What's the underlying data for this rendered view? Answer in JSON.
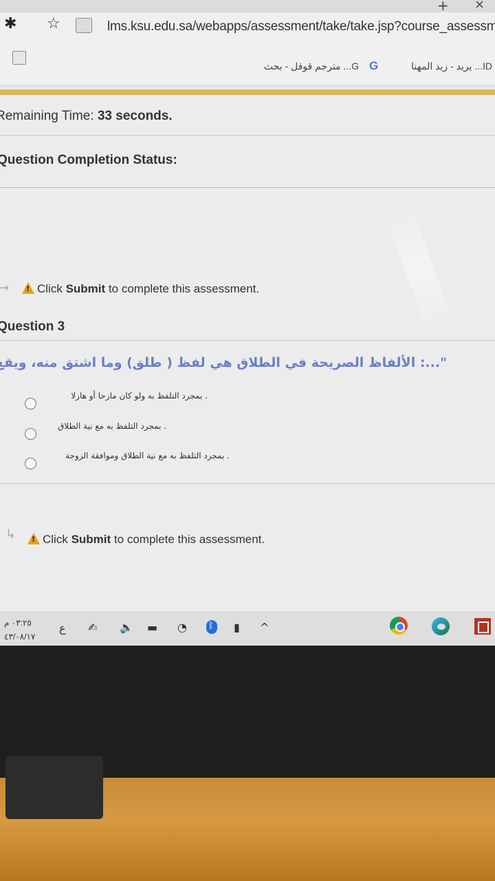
{
  "browser": {
    "url": "lms.ksu.edu.sa/webapps/assessment/take/take.jsp?course_assessm",
    "new_tab_glyph": "+",
    "close_glyph": "×",
    "bookmarks": [
      {
        "label": "يريد - زيد المهنا ...ID"
      },
      {
        "label": "مترجم قوقل - بحث ...G"
      }
    ],
    "google_icon_glyph": "G"
  },
  "assessment": {
    "remaining_label": "Remaining Time:",
    "remaining_value": "33",
    "remaining_unit": "seconds.",
    "completion_label": "Question Completion Status:",
    "submit_click": "Click",
    "submit_word": "Submit",
    "submit_rest": "to complete this assessment.",
    "question_label": "Question 3",
    "question_text": "\"...: الألفاظ الصريحة في الطلاق هي لفظ ( طلق) وما اشتق منه، ويقع به الطلاق\"",
    "options": [
      ". بمجرد التلفظ به ولو كان مازحا أو هازلا",
      ". بمجرد التلفظ به مع نية الطلاق",
      ". بمجرد التلفظ به مع نية الطلاق وموافقة الزوجة"
    ]
  },
  "taskbar": {
    "time": "٠٣:٢٥ م",
    "date": "٤٣/٠٨/١٧",
    "language": "ع",
    "icons": [
      "pen-icon",
      "volume-icon",
      "battery-icon",
      "wifi-icon",
      "bluetooth-icon",
      "usb-icon",
      "chevron-up-icon",
      "chrome-icon",
      "edge-icon",
      "office-icon"
    ]
  }
}
